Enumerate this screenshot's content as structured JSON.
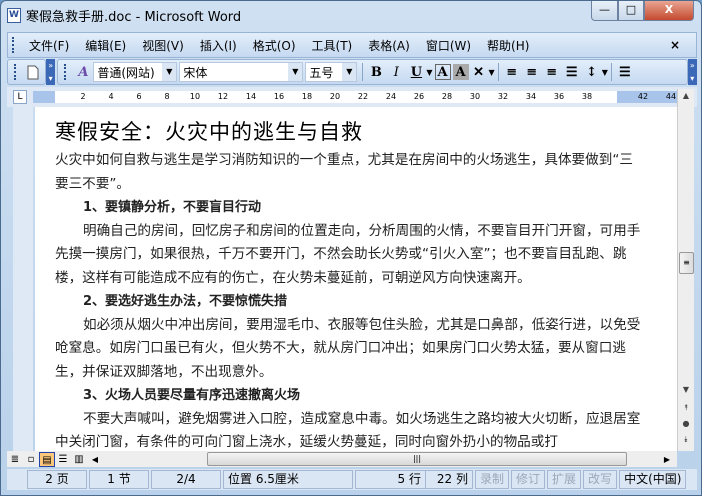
{
  "window": {
    "title": "寒假急救手册.doc - Microsoft Word",
    "app_icon": "W",
    "min": "—",
    "max": "□",
    "close": "X"
  },
  "menu": {
    "items": [
      "文件(F)",
      "编辑(E)",
      "视图(V)",
      "插入(I)",
      "格式(O)",
      "工具(T)",
      "表格(A)",
      "窗口(W)",
      "帮助(H)"
    ],
    "close": "×"
  },
  "toolbar": {
    "style": "普通(网站)",
    "font": "宋体",
    "size": "五号",
    "bold": "B",
    "italic": "I",
    "underline": "U",
    "border_char": "A",
    "shade_char": "A"
  },
  "ruler": {
    "ticks": [
      "2",
      "4",
      "6",
      "8",
      "10",
      "12",
      "14",
      "16",
      "18",
      "20",
      "22",
      "24",
      "26",
      "28",
      "30",
      "32",
      "34",
      "36",
      "38",
      "42",
      "44"
    ],
    "corner": "L"
  },
  "document": {
    "title": "寒假安全：火灾中的逃生与自救",
    "paragraphs": [
      {
        "type": "normal",
        "text": "火灾中如何自救与逃生是学习消防知识的一个重点，尤其是在房间中的火场逃生，具体要做到“三要三不要”。"
      },
      {
        "type": "heading",
        "text": "1、要镇静分析，不要盲目行动"
      },
      {
        "type": "indent",
        "text": "明确自己的房间，回忆房子和房间的位置走向，分析周围的火情，不要盲目开门开窗，可用手先摸一摸房门，如果很热，千万不要开门，不然会助长火势或“引火入室”；也不要盲目乱跑、跳楼，这样有可能造成不应有的伤亡，在火势未蔓延前，可朝逆风方向快速离开。"
      },
      {
        "type": "heading",
        "text": "2、要选好逃生办法，不要惊慌失措"
      },
      {
        "type": "indent",
        "text": "如必须从烟火中冲出房间，要用湿毛巾、衣服等包住头脸，尤其是口鼻部，低姿行进，以免受呛窒息。如房门口虽已有火，但火势不大，就从房门口冲出；如果房门口火势太猛，要从窗口逃生，并保证双脚落地，不出现意外。"
      },
      {
        "type": "heading",
        "text": "3、火场人员要尽量有序迅速撤离火场"
      },
      {
        "type": "indent",
        "text": "不要大声喊叫，避免烟雾进入口腔，造成窒息中毒。如火场逃生之路均被大火切断，应退居室中关闭门窗，有条件的可向门窗上浇水，延缓火势蔓延，同时向窗外扔小的物品或打"
      }
    ]
  },
  "status": {
    "page": "2 页",
    "section": "1 节",
    "pages": "2/4",
    "position": "位置 6.5厘米",
    "line": "5 行",
    "col": "22 列",
    "rec": "录制",
    "trk": "修订",
    "ext": "扩展",
    "ovr": "改写",
    "lang": "中文(中国)"
  }
}
